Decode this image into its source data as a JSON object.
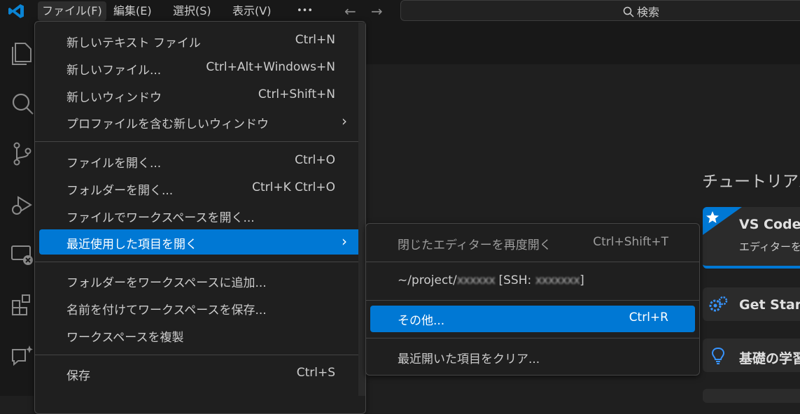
{
  "titlebar": {
    "menus": [
      "ファイル(F)",
      "編集(E)",
      "選択(S)",
      "表示(V)",
      "•••"
    ],
    "search_label": "検索"
  },
  "file_menu": {
    "items": [
      {
        "label": "新しいテキスト ファイル",
        "shortcut": "Ctrl+N"
      },
      {
        "label": "新しいファイル...",
        "shortcut": "Ctrl+Alt+Windows+N"
      },
      {
        "label": "新しいウィンドウ",
        "shortcut": "Ctrl+Shift+N"
      },
      {
        "label": "プロファイルを含む新しいウィンドウ",
        "shortcut": ""
      },
      {
        "label": "ファイルを開く...",
        "shortcut": "Ctrl+O"
      },
      {
        "label": "フォルダーを開く...",
        "shortcut": "Ctrl+K Ctrl+O"
      },
      {
        "label": "ファイルでワークスペースを開く...",
        "shortcut": ""
      },
      {
        "label": "最近使用した項目を開く",
        "shortcut": ""
      },
      {
        "label": "フォルダーをワークスペースに追加...",
        "shortcut": ""
      },
      {
        "label": "名前を付けてワークスペースを保存...",
        "shortcut": ""
      },
      {
        "label": "ワークスペースを複製",
        "shortcut": ""
      },
      {
        "label": "保存",
        "shortcut": "Ctrl+S"
      }
    ]
  },
  "recent_menu": {
    "reopen_label": "閉じたエディターを再度開く",
    "reopen_shortcut": "Ctrl+Shift+T",
    "recent_path_prefix": "~/project/",
    "recent_path_hidden": "xxxxxx",
    "recent_ssh_prefix": " [SSH: ",
    "recent_ssh_hidden": "xxxxxxx",
    "recent_ssh_suffix": "]",
    "more_label": "その他...",
    "more_shortcut": "Ctrl+R",
    "clear_label": "最近開いた項目をクリア..."
  },
  "welcome": {
    "tutorial_heading": "チュートリアル",
    "card1_title": "VS Code (",
    "card1_sub": "エディターを",
    "card2_title": "Get Starte",
    "card3_title": "基礎の学習"
  },
  "colors": {
    "accent": "#0078d4",
    "background": "#1f1f1f",
    "menu_border": "#454545"
  },
  "icons": [
    "vscode-logo-icon",
    "explorer-icon",
    "search-icon",
    "source-control-icon",
    "run-debug-icon",
    "remote-explorer-icon",
    "extensions-icon",
    "chat-icon"
  ]
}
